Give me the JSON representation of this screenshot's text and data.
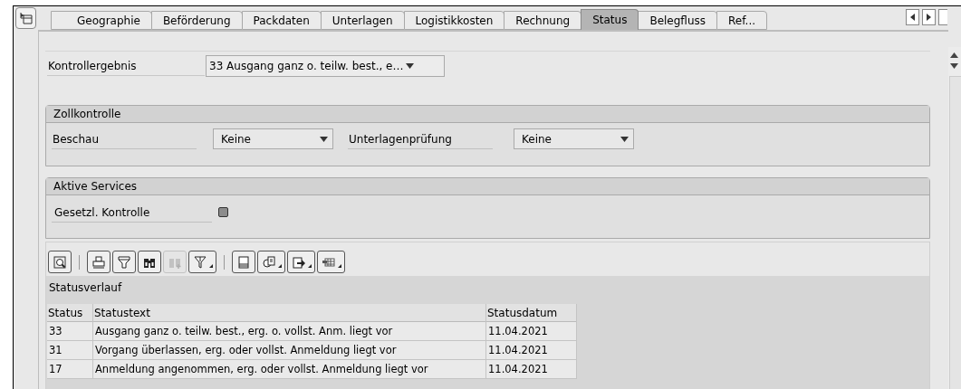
{
  "tabs": [
    {
      "label": "Geographie",
      "selected": false
    },
    {
      "label": "Beförderung",
      "selected": false
    },
    {
      "label": "Packdaten",
      "selected": false
    },
    {
      "label": "Unterlagen",
      "selected": false
    },
    {
      "label": "Logistikkosten",
      "selected": false
    },
    {
      "label": "Rechnung",
      "selected": false
    },
    {
      "label": "Status",
      "selected": true
    },
    {
      "label": "Belegfluss",
      "selected": false
    },
    {
      "label": "Ref...",
      "selected": false
    }
  ],
  "kontrollergebnis": {
    "label": "Kontrollergebnis",
    "value": "33 Ausgang ganz o. teilw. best., e…"
  },
  "zollkontrolle": {
    "title": "Zollkontrolle",
    "fields": [
      {
        "label": "Beschau",
        "value": "Keine"
      },
      {
        "label": "Unterlagenprüfung",
        "value": "Keine"
      }
    ]
  },
  "aktive_services": {
    "title": "Aktive Services",
    "label": "Gesetzl. Kontrolle"
  },
  "toolbar": [
    {
      "kind": "details",
      "disabled": false,
      "menu": false
    },
    {
      "kind": "sep"
    },
    {
      "kind": "print",
      "disabled": false,
      "menu": false
    },
    {
      "kind": "sort",
      "disabled": false,
      "menu": false
    },
    {
      "kind": "find",
      "disabled": false,
      "menu": false
    },
    {
      "kind": "findnext",
      "disabled": true,
      "menu": false
    },
    {
      "kind": "filter",
      "disabled": false,
      "menu": true
    },
    {
      "kind": "sep"
    },
    {
      "kind": "preview",
      "disabled": false,
      "menu": false
    },
    {
      "kind": "views",
      "disabled": false,
      "menu": true
    },
    {
      "kind": "export",
      "disabled": false,
      "menu": true
    },
    {
      "kind": "layout",
      "disabled": false,
      "menu": true
    }
  ],
  "table": {
    "title": "Statusverlauf",
    "columns": [
      "Status",
      "Statustext",
      "Statusdatum"
    ],
    "rows": [
      [
        "33",
        "Ausgang ganz o. teilw. best., erg. o. vollst. Anm. liegt vor",
        "11.04.2021"
      ],
      [
        "31",
        "Vorgang überlassen, erg. oder vollst. Anmeldung liegt vor",
        "11.04.2021"
      ],
      [
        "17",
        "Anmeldung angenommen, erg. oder vollst. Anmeldung liegt vor",
        "11.04.2021"
      ]
    ]
  }
}
